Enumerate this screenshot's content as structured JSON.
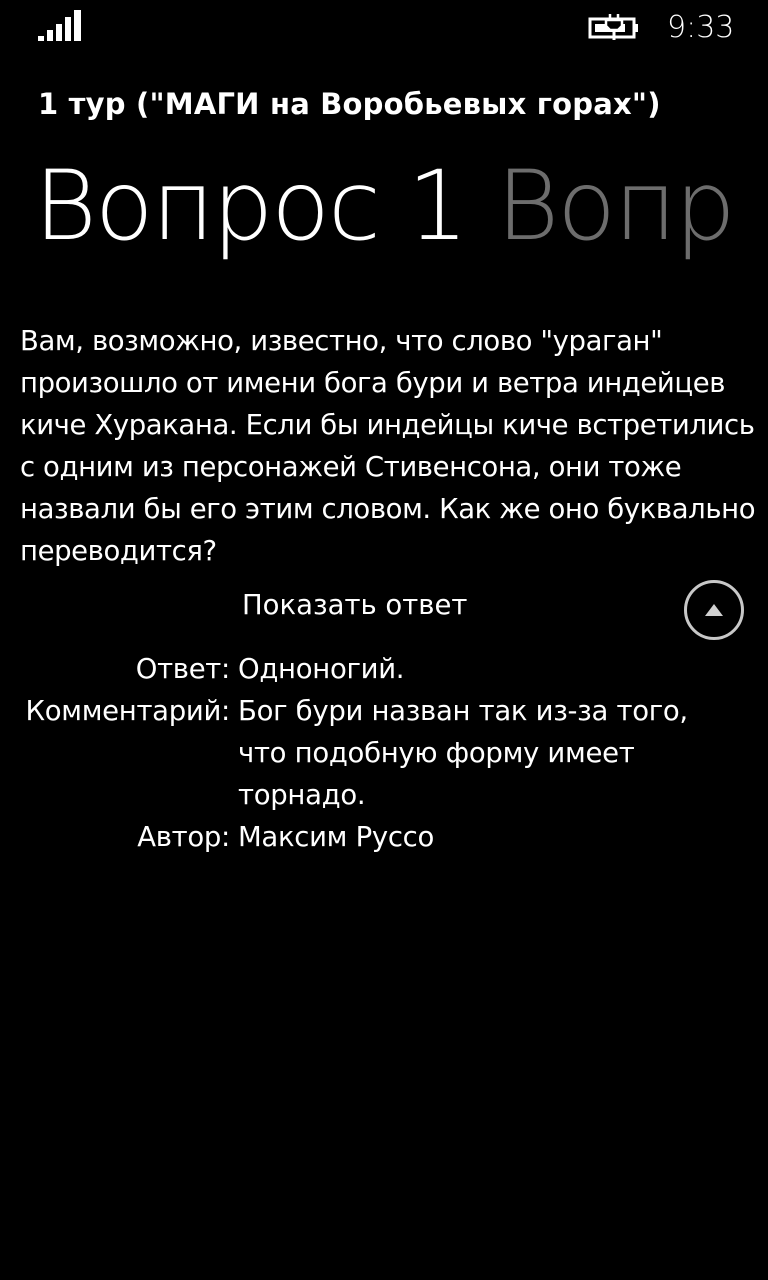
{
  "status_bar": {
    "time": "9:33",
    "signal_icon": "signal-strength-icon",
    "battery_icon": "battery-charging-icon"
  },
  "header": {
    "tour_title": "1 тур (\"МАГИ на Воробьевых горах\")",
    "pivot_items": [
      {
        "label": "Вопрос 1",
        "active": true
      },
      {
        "label": "Вопр",
        "active": false
      }
    ]
  },
  "question": {
    "text": "Вам, возможно, известно, что слово \"ураган\" произошло от имени бога бури и ветра индейцев киче Хуракана. Если бы индейцы киче встретились с одним из персонажей Стивенсона, они тоже назвали бы его этим словом. Как же оно буквально переводится?",
    "show_answer_label": "Показать ответ",
    "scroll_up_icon": "arrow-up-circle-icon"
  },
  "answer": {
    "answer_label": "Ответ:",
    "answer_value": "Одноногий.",
    "comment_label": "Комментарий:",
    "comment_value": "Бог бури назван так из-за того, что подобную форму имеет торнадо.",
    "author_label": "Автор:",
    "author_value": "Максим Руссо"
  },
  "colors": {
    "background": "#000000",
    "text": "#ffffff",
    "inactive_pivot": "#6d6d6d"
  }
}
